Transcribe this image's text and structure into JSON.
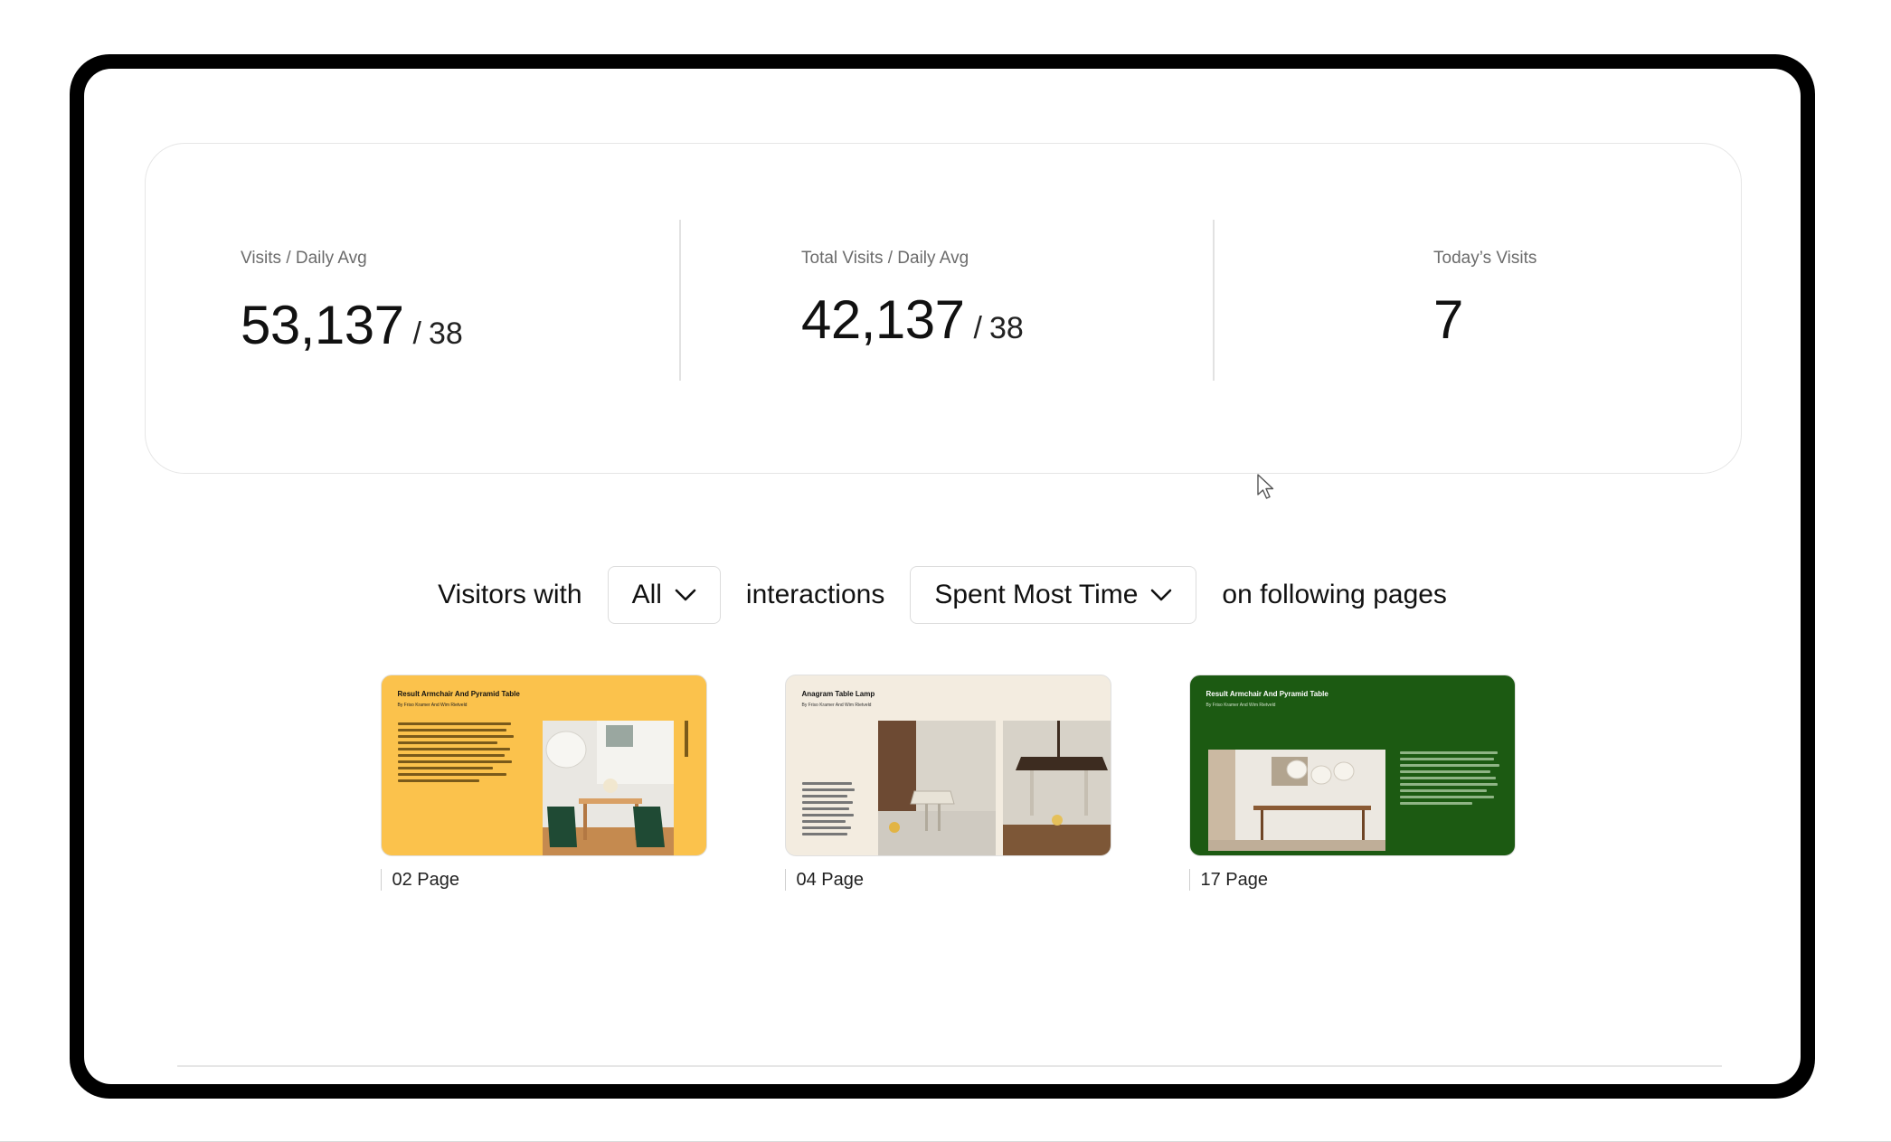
{
  "stats": {
    "visits_daily": {
      "label": "Visits / Daily Avg",
      "value": "53,137",
      "slash": "/",
      "avg": "38"
    },
    "total_visits_daily": {
      "label": "Total Visits / Daily Avg",
      "value": "42,137",
      "slash": "/",
      "avg": "38"
    },
    "todays_visits": {
      "label": "Today’s Visits",
      "value": "7"
    }
  },
  "filter": {
    "prefix": "Visitors with",
    "interaction_select": "All",
    "middle": "interactions",
    "time_select": "Spent Most Time",
    "suffix": "on following pages"
  },
  "pages": [
    {
      "label": "02 Page",
      "title": "Result Armchair And Pyramid Table",
      "subtitle": "By Friso Kramer And Wim Rietveld",
      "bg": "#fbc24c"
    },
    {
      "label": "04 Page",
      "title": "Anagram Table Lamp",
      "subtitle": "By Friso Kramer And Wim Rietveld",
      "bg": "#f3ece0"
    },
    {
      "label": "17 Page",
      "title": "Result Armchair And Pyramid Table",
      "subtitle": "By Friso Kramer And Wim Rietveld",
      "bg": "#1c5a12"
    }
  ],
  "colors": {
    "card_border": "#e6e6e6",
    "device_frame": "#000000"
  }
}
